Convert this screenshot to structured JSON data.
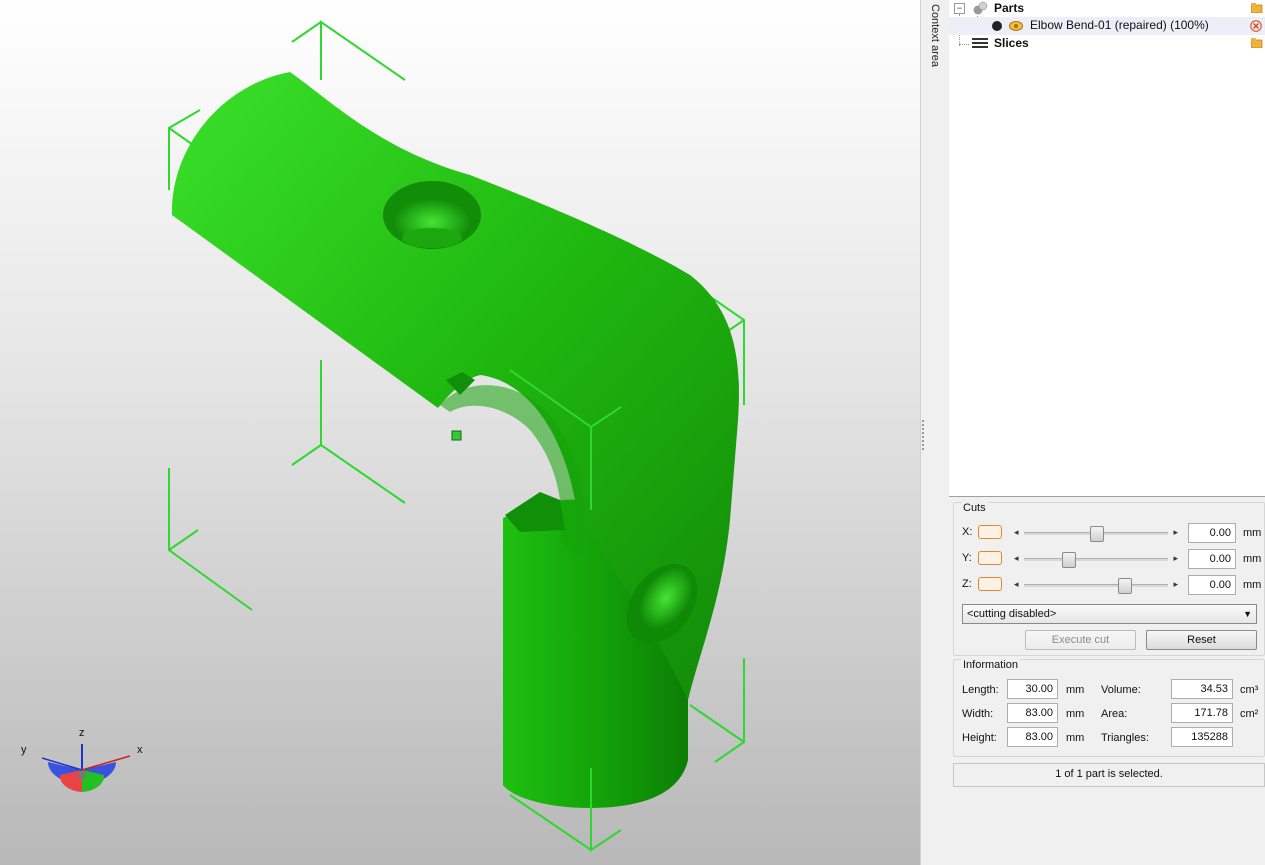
{
  "context_label": "Context area",
  "tree": {
    "parts_label": "Parts",
    "part_name": "Elbow Bend-01 (repaired) (100%)",
    "slices_label": "Slices"
  },
  "cuts": {
    "title": "Cuts",
    "rows": [
      {
        "axis": "X:",
        "value": "0.00",
        "unit": "mm",
        "slider_fraction": 0.5
      },
      {
        "axis": "Y:",
        "value": "0.00",
        "unit": "mm",
        "slider_fraction": 0.29
      },
      {
        "axis": "Z:",
        "value": "0.00",
        "unit": "mm",
        "slider_fraction": 0.71
      }
    ],
    "mode_selected": "<cutting disabled>",
    "execute_label": "Execute cut",
    "reset_label": "Reset"
  },
  "info": {
    "title": "Information",
    "length_label": "Length:",
    "length_value": "30.00",
    "length_unit": "mm",
    "width_label": "Width:",
    "width_value": "83.00",
    "width_unit": "mm",
    "height_label": "Height:",
    "height_value": "83.00",
    "height_unit": "mm",
    "volume_label": "Volume:",
    "volume_value": "34.53",
    "volume_unit": "cm³",
    "area_label": "Area:",
    "area_value": "171.78",
    "area_unit": "cm²",
    "triangles_label": "Triangles:",
    "triangles_value": "135288"
  },
  "status": "1 of 1 part is selected.",
  "axes_gizmo": {
    "x": "x",
    "y": "y",
    "z": "z"
  },
  "colors": {
    "model_green": "#22c012",
    "bbox_green": "#2ed82e",
    "check_orange": "#e08a30"
  }
}
